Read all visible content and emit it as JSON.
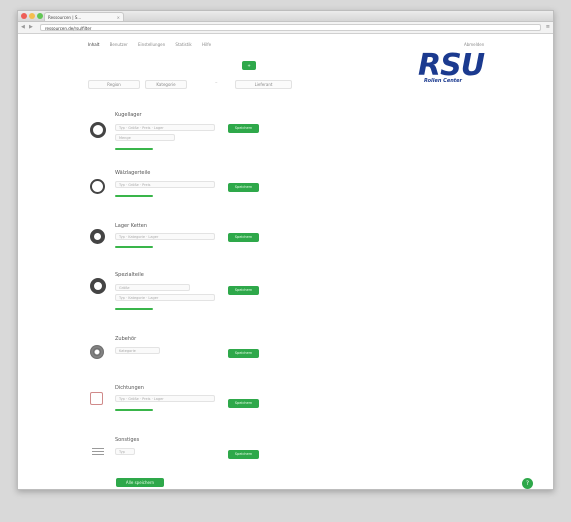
{
  "browser": {
    "tab_title": "Ressourcen | S...",
    "tab_close": "×",
    "url": "ressourcen.de/rsu/filter",
    "back": "◀",
    "forward": "▶",
    "menu": "≡"
  },
  "nav": {
    "items": [
      "Inhalt",
      "Benutzer",
      "Einstellungen",
      "Statistik",
      "Hilfe"
    ],
    "logout": "Abmelden"
  },
  "logo": {
    "text": "RSU",
    "subtitle": "Rollen Center",
    "color": "#1b3a8f"
  },
  "toolbar": {
    "top_button": "+"
  },
  "filters": {
    "select_a": "Region",
    "select_b": "Kategorie",
    "dash": "–",
    "select_c": "Lieferant"
  },
  "items": [
    {
      "title": "Kugellager",
      "row1": "Typ · Größe · Preis · Lager",
      "row2": "Menge",
      "button": "Speichern",
      "icon": "ring-icon"
    },
    {
      "title": "Wälzlagerteile",
      "row1": "Typ · Größe · Preis",
      "button": "Speichern",
      "icon": "ring-icon"
    },
    {
      "title": "Lager Ketten",
      "row1": "Typ · Kategorie · Lager",
      "button": "Speichern",
      "icon": "ring-icon"
    },
    {
      "title": "Spezialteile",
      "row1": "Größe",
      "row2": "Typ · Kategorie · Lager",
      "button": "Speichern",
      "icon": "ring-icon"
    },
    {
      "title": "Zubehör",
      "row1": "Kategorie",
      "button": "Speichern",
      "icon": "gear-icon"
    },
    {
      "title": "Dichtungen",
      "row1": "Typ · Größe · Preis · Lager",
      "button": "Speichern",
      "icon": "square-icon"
    },
    {
      "title": "Sonstiges",
      "row1": "Typ",
      "button": "Speichern",
      "icon": "list-icon"
    }
  ],
  "footer": {
    "save_label": "Alle speichern",
    "help_label": "?"
  },
  "colors": {
    "accent": "#2ea84a",
    "brand": "#1b3a8f"
  }
}
